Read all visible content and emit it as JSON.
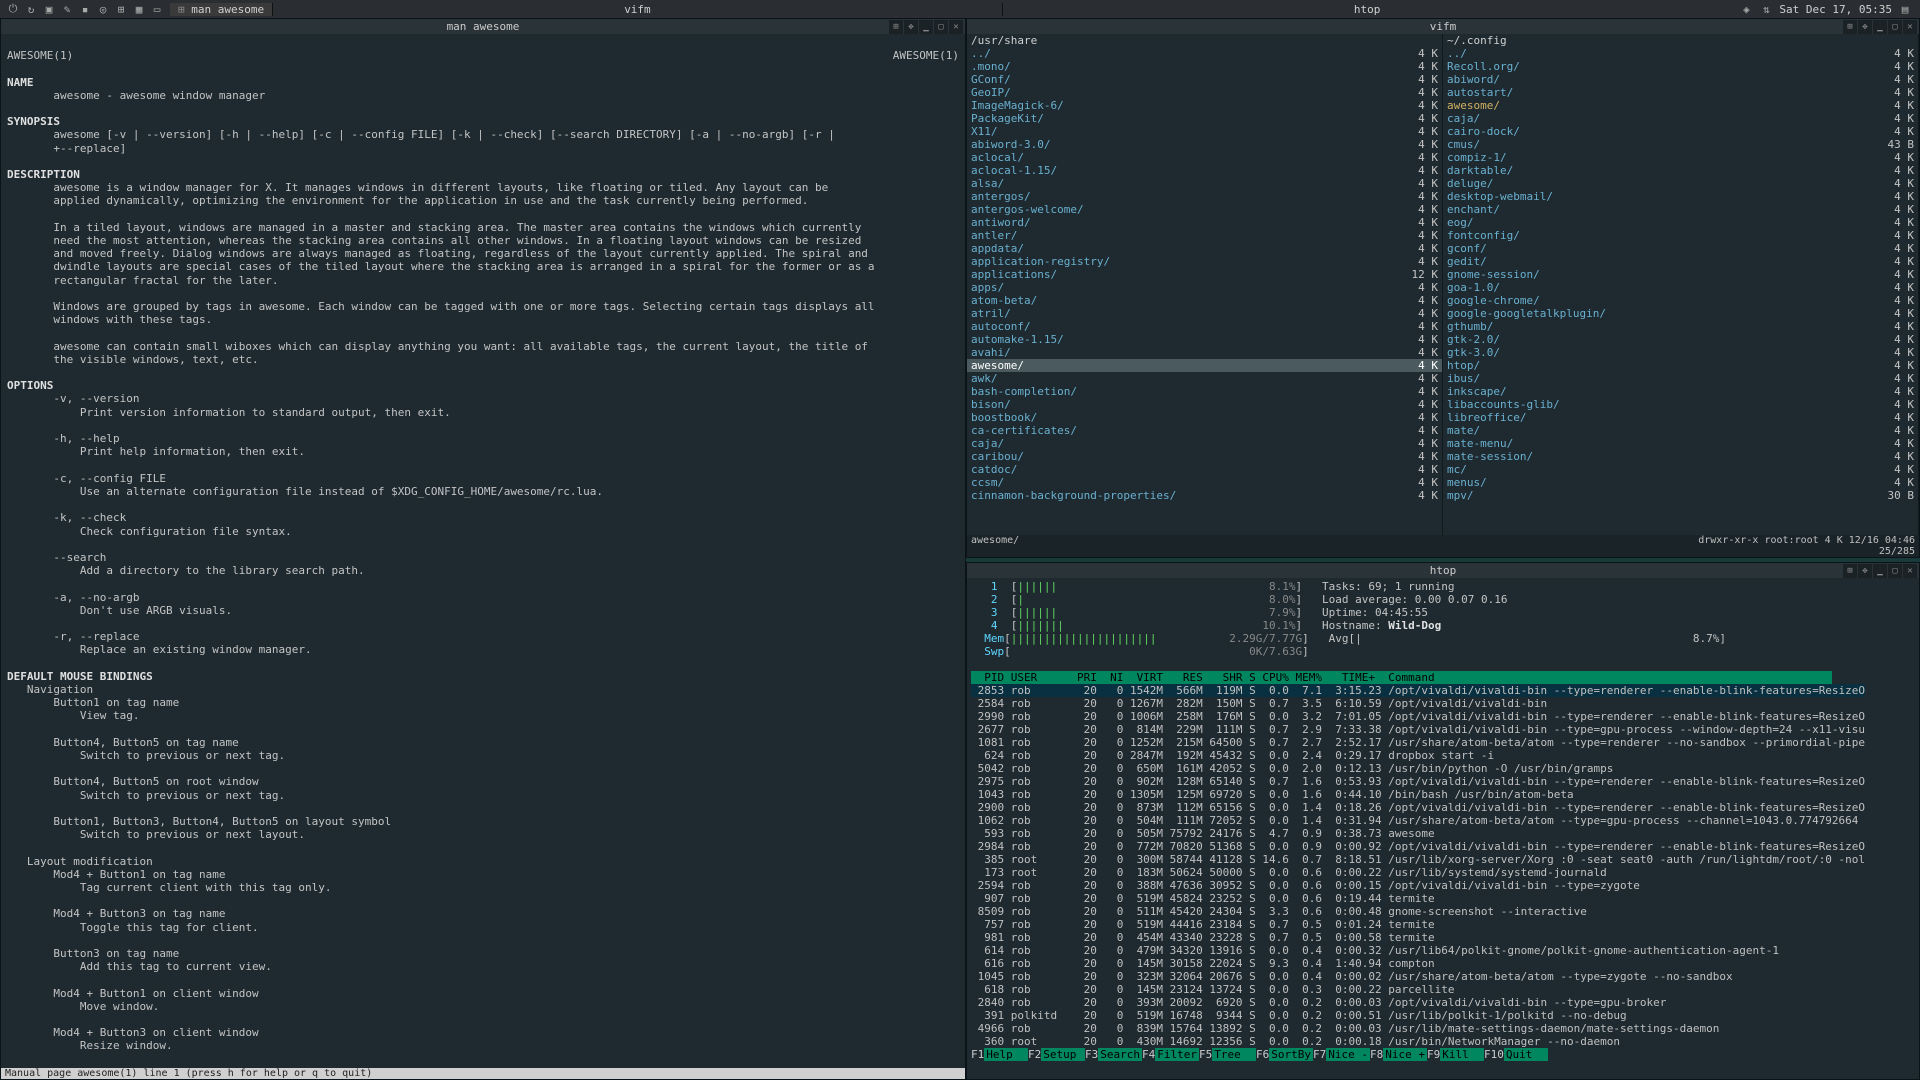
{
  "taskbar": {
    "app_title": "man awesome",
    "tasks": [
      "vifm",
      "htop"
    ],
    "clock": "Sat Dec 17, 05:35",
    "launcher_icons": [
      "power",
      "refresh",
      "folder",
      "edit",
      "terminal",
      "web",
      "files",
      "grid",
      "monitor"
    ],
    "tray_icons": [
      "dropbox",
      "network",
      "volume"
    ]
  },
  "man": {
    "title": "man awesome",
    "header_left": "AWESOME(1)",
    "header_right": "AWESOME(1)",
    "sections": {
      "name_h": "NAME",
      "name_t": "       awesome - awesome window manager",
      "syn_h": "SYNOPSIS",
      "syn_t": "       awesome [-v | --version] [-h | --help] [-c | --config FILE] [-k | --check] [--search DIRECTORY] [-a | --no-argb] [-r |\n       +--replace]",
      "desc_h": "DESCRIPTION",
      "desc_t": "       awesome is a window manager for X. It manages windows in different layouts, like floating or tiled. Any layout can be\n       applied dynamically, optimizing the environment for the application in use and the task currently being performed.\n\n       In a tiled layout, windows are managed in a master and stacking area. The master area contains the windows which currently\n       need the most attention, whereas the stacking area contains all other windows. In a floating layout windows can be resized\n       and moved freely. Dialog windows are always managed as floating, regardless of the layout currently applied. The spiral and\n       dwindle layouts are special cases of the tiled layout where the stacking area is arranged in a spiral for the former or as a\n       rectangular fractal for the later.\n\n       Windows are grouped by tags in awesome. Each window can be tagged with one or more tags. Selecting certain tags displays all\n       windows with these tags.\n\n       awesome can contain small wiboxes which can display anything you want: all available tags, the current layout, the title of\n       the visible windows, text, etc.",
      "opt_h": "OPTIONS",
      "opt_t": "       -v, --version\n           Print version information to standard output, then exit.\n\n       -h, --help\n           Print help information, then exit.\n\n       -c, --config FILE\n           Use an alternate configuration file instead of $XDG_CONFIG_HOME/awesome/rc.lua.\n\n       -k, --check\n           Check configuration file syntax.\n\n       --search\n           Add a directory to the library search path.\n\n       -a, --no-argb\n           Don't use ARGB visuals.\n\n       -r, --replace\n           Replace an existing window manager.",
      "dmb_h": "DEFAULT MOUSE BINDINGS",
      "dmb_t": "   Navigation\n       Button1 on tag name\n           View tag.\n\n       Button4, Button5 on tag name\n           Switch to previous or next tag.\n\n       Button4, Button5 on root window\n           Switch to previous or next tag.\n\n       Button1, Button3, Button4, Button5 on layout symbol\n           Switch to previous or next layout.\n\n   Layout modification\n       Mod4 + Button1 on tag name\n           Tag current client with this tag only.\n\n       Mod4 + Button3 on tag name\n           Toggle this tag for client.\n\n       Button3 on tag name\n           Add this tag to current view.\n\n       Mod4 + Button1 on client window\n           Move window.\n\n       Mod4 + Button3 on client window\n           Resize window."
    },
    "status": " Manual page awesome(1) line 1 (press h for help or q to quit)"
  },
  "vifm": {
    "title": "vifm",
    "left": {
      "path": "/usr/share",
      "selected": "awesome/",
      "items": [
        {
          "n": "../",
          "s": "4 K"
        },
        {
          "n": ".mono/",
          "s": "4 K"
        },
        {
          "n": "GConf/",
          "s": "4 K"
        },
        {
          "n": "GeoIP/",
          "s": "4 K"
        },
        {
          "n": "ImageMagick-6/",
          "s": "4 K"
        },
        {
          "n": "PackageKit/",
          "s": "4 K"
        },
        {
          "n": "X11/",
          "s": "4 K"
        },
        {
          "n": "abiword-3.0/",
          "s": "4 K"
        },
        {
          "n": "aclocal/",
          "s": "4 K"
        },
        {
          "n": "aclocal-1.15/",
          "s": "4 K"
        },
        {
          "n": "alsa/",
          "s": "4 K"
        },
        {
          "n": "antergos/",
          "s": "4 K"
        },
        {
          "n": "antergos-welcome/",
          "s": "4 K"
        },
        {
          "n": "antiword/",
          "s": "4 K"
        },
        {
          "n": "antler/",
          "s": "4 K"
        },
        {
          "n": "appdata/",
          "s": "4 K"
        },
        {
          "n": "application-registry/",
          "s": "4 K"
        },
        {
          "n": "applications/",
          "s": "12 K"
        },
        {
          "n": "apps/",
          "s": "4 K"
        },
        {
          "n": "atom-beta/",
          "s": "4 K"
        },
        {
          "n": "atril/",
          "s": "4 K"
        },
        {
          "n": "autoconf/",
          "s": "4 K"
        },
        {
          "n": "automake-1.15/",
          "s": "4 K"
        },
        {
          "n": "avahi/",
          "s": "4 K"
        },
        {
          "n": "awesome/",
          "s": "4 K",
          "sel": true
        },
        {
          "n": "awk/",
          "s": "4 K"
        },
        {
          "n": "bash-completion/",
          "s": "4 K"
        },
        {
          "n": "bison/",
          "s": "4 K"
        },
        {
          "n": "boostbook/",
          "s": "4 K"
        },
        {
          "n": "ca-certificates/",
          "s": "4 K"
        },
        {
          "n": "caja/",
          "s": "4 K"
        },
        {
          "n": "caribou/",
          "s": "4 K"
        },
        {
          "n": "catdoc/",
          "s": "4 K"
        },
        {
          "n": "ccsm/",
          "s": "4 K"
        },
        {
          "n": "cinnamon-background-properties/",
          "s": "4 K"
        }
      ]
    },
    "right": {
      "path": "~/.config",
      "items": [
        {
          "n": "../",
          "s": "4 K"
        },
        {
          "n": "Recoll.org/",
          "s": "4 K"
        },
        {
          "n": "abiword/",
          "s": "4 K"
        },
        {
          "n": "autostart/",
          "s": "4 K"
        },
        {
          "n": "awesome/",
          "s": "4 K",
          "hi": true
        },
        {
          "n": "caja/",
          "s": "4 K"
        },
        {
          "n": "cairo-dock/",
          "s": "4 K"
        },
        {
          "n": "cmus/",
          "s": "43 B"
        },
        {
          "n": "compiz-1/",
          "s": "4 K"
        },
        {
          "n": "darktable/",
          "s": "4 K"
        },
        {
          "n": "deluge/",
          "s": "4 K"
        },
        {
          "n": "desktop-webmail/",
          "s": "4 K"
        },
        {
          "n": "enchant/",
          "s": "4 K"
        },
        {
          "n": "eog/",
          "s": "4 K"
        },
        {
          "n": "fontconfig/",
          "s": "4 K"
        },
        {
          "n": "gconf/",
          "s": "4 K"
        },
        {
          "n": "gedit/",
          "s": "4 K"
        },
        {
          "n": "gnome-session/",
          "s": "4 K"
        },
        {
          "n": "goa-1.0/",
          "s": "4 K"
        },
        {
          "n": "google-chrome/",
          "s": "4 K"
        },
        {
          "n": "google-googletalkplugin/",
          "s": "4 K"
        },
        {
          "n": "gthumb/",
          "s": "4 K"
        },
        {
          "n": "gtk-2.0/",
          "s": "4 K"
        },
        {
          "n": "gtk-3.0/",
          "s": "4 K"
        },
        {
          "n": "htop/",
          "s": "4 K"
        },
        {
          "n": "ibus/",
          "s": "4 K"
        },
        {
          "n": "inkscape/",
          "s": "4 K"
        },
        {
          "n": "libaccounts-glib/",
          "s": "4 K"
        },
        {
          "n": "libreoffice/",
          "s": "4 K"
        },
        {
          "n": "mate/",
          "s": "4 K"
        },
        {
          "n": "mate-menu/",
          "s": "4 K"
        },
        {
          "n": "mate-session/",
          "s": "4 K"
        },
        {
          "n": "mc/",
          "s": "4 K"
        },
        {
          "n": "menus/",
          "s": "4 K"
        },
        {
          "n": "mpv/",
          "s": "30 B"
        }
      ]
    },
    "status_left": "awesome/",
    "status_mid": "drwxr-xr-x    root:root           4 K   12/16 04:46",
    "status_right": "25/285"
  },
  "htop": {
    "title": "htop",
    "meters": {
      "cpu": [
        {
          "n": "1",
          "bar": "||||||",
          "pct": "8.1%"
        },
        {
          "n": "2",
          "bar": "|",
          "pct": "8.0%"
        },
        {
          "n": "3",
          "bar": "||||||",
          "pct": "7.9%"
        },
        {
          "n": "4",
          "bar": "|||||||",
          "pct": "10.1%"
        }
      ],
      "mem": {
        "label": "Mem",
        "bar": "||||||||||||||||||||||",
        "val": "2.29G/7.77G"
      },
      "swp": {
        "label": "Swp",
        "bar": "",
        "val": "0K/7.63G"
      },
      "tasks": "Tasks: 69; 1 running",
      "load": "Load average: 0.00 0.07 0.16",
      "uptime": "Uptime: 04:45:55",
      "host_l": "Hostname: ",
      "host_v": "Wild-Dog",
      "avg": "Avg[|                                                  8.7%]"
    },
    "header": "  PID USER      PRI  NI  VIRT   RES   SHR S CPU% MEM%   TIME+  Command",
    "procs": [
      {
        "t": " 2853 rob        20   0 1542M  566M  119M S  0.0  7.1  3:15.23 /opt/vivaldi/vivaldi-bin --type=renderer --enable-blink-features=ResizeO",
        "hi": true
      },
      {
        "t": " 2584 rob        20   0 1267M  282M  150M S  0.7  3.5  6:10.59 /opt/vivaldi/vivaldi-bin"
      },
      {
        "t": " 2990 rob        20   0 1006M  258M  176M S  0.0  3.2  7:01.05 /opt/vivaldi/vivaldi-bin --type=renderer --enable-blink-features=ResizeO"
      },
      {
        "t": " 2677 rob        20   0  814M  229M  111M S  0.7  2.9  7:33.38 /opt/vivaldi/vivaldi-bin --type=gpu-process --window-depth=24 --x11-visu"
      },
      {
        "t": " 1081 rob        20   0 1252M  215M 64500 S  0.7  2.7  2:52.17 /usr/share/atom-beta/atom --type=renderer --no-sandbox --primordial-pipe"
      },
      {
        "t": "  624 rob        20   0 2847M  192M 45432 S  0.0  2.4  0:29.17 dropbox start -i"
      },
      {
        "t": " 5042 rob        20   0  650M  161M 42052 S  0.0  2.0  0:12.13 /usr/bin/python -O /usr/bin/gramps"
      },
      {
        "t": " 2975 rob        20   0  902M  128M 65140 S  0.7  1.6  0:53.93 /opt/vivaldi/vivaldi-bin --type=renderer --enable-blink-features=ResizeO"
      },
      {
        "t": " 1043 rob        20   0 1305M  125M 69720 S  0.0  1.6  0:44.10 /bin/bash /usr/bin/atom-beta"
      },
      {
        "t": " 2900 rob        20   0  873M  112M 65156 S  0.0  1.4  0:18.26 /opt/vivaldi/vivaldi-bin --type=renderer --enable-blink-features=ResizeO"
      },
      {
        "t": " 1062 rob        20   0  504M  111M 72052 S  0.0  1.4  0:31.94 /usr/share/atom-beta/atom --type=gpu-process --channel=1043.0.774792664"
      },
      {
        "t": "  593 rob        20   0  505M 75792 24176 S  4.7  0.9  0:38.73 awesome"
      },
      {
        "t": " 2984 rob        20   0  772M 70820 51368 S  0.0  0.9  0:00.92 /opt/vivaldi/vivaldi-bin --type=renderer --enable-blink-features=ResizeO"
      },
      {
        "t": "  385 root       20   0  300M 58744 41128 S 14.6  0.7  8:18.51 /usr/lib/xorg-server/Xorg :0 -seat seat0 -auth /run/lightdm/root/:0 -nol"
      },
      {
        "t": "  173 root       20   0  183M 50624 50000 S  0.0  0.6  0:00.22 /usr/lib/systemd/systemd-journald"
      },
      {
        "t": " 2594 rob        20   0  388M 47636 30952 S  0.0  0.6  0:00.15 /opt/vivaldi/vivaldi-bin --type=zygote"
      },
      {
        "t": "  907 rob        20   0  519M 45824 23252 S  0.0  0.6  0:19.44 termite"
      },
      {
        "t": " 8509 rob        20   0  511M 45420 24304 S  3.3  0.6  0:00.48 gnome-screenshot --interactive"
      },
      {
        "t": "  757 rob        20   0  519M 44416 23184 S  0.7  0.5  0:01.24 termite"
      },
      {
        "t": "  981 rob        20   0  454M 43340 23228 S  0.7  0.5  0:00.58 termite"
      },
      {
        "t": "  614 rob        20   0  479M 34320 13916 S  0.0  0.4  0:00.32 /usr/lib64/polkit-gnome/polkit-gnome-authentication-agent-1"
      },
      {
        "t": "  616 rob        20   0  145M 30158 22024 S  9.3  0.4  1:40.94 compton"
      },
      {
        "t": " 1045 rob        20   0  323M 32064 20676 S  0.0  0.4  0:00.02 /usr/share/atom-beta/atom --type=zygote --no-sandbox"
      },
      {
        "t": "  618 rob        20   0  145M 23124 13724 S  0.0  0.3  0:00.22 parcellite"
      },
      {
        "t": " 2840 rob        20   0  393M 20092  6920 S  0.0  0.2  0:00.03 /opt/vivaldi/vivaldi-bin --type=gpu-broker"
      },
      {
        "t": "  391 polkitd    20   0  519M 16748  9344 S  0.0  0.2  0:00.51 /usr/lib/polkit-1/polkitd --no-debug"
      },
      {
        "t": " 4966 rob        20   0  839M 15764 13892 S  0.0  0.2  0:00.03 /usr/lib/mate-settings-daemon/mate-settings-daemon"
      },
      {
        "t": "  360 root       20   0  430M 14692 12356 S  0.0  0.2  0:00.18 /usr/bin/NetworkManager --no-daemon"
      }
    ],
    "fkeys": [
      {
        "k": "F1",
        "l": "Help"
      },
      {
        "k": "F2",
        "l": "Setup"
      },
      {
        "k": "F3",
        "l": "Search"
      },
      {
        "k": "F4",
        "l": "Filter"
      },
      {
        "k": "F5",
        "l": "Tree"
      },
      {
        "k": "F6",
        "l": "SortBy"
      },
      {
        "k": "F7",
        "l": "Nice -"
      },
      {
        "k": "F8",
        "l": "Nice +"
      },
      {
        "k": "F9",
        "l": "Kill"
      },
      {
        "k": "F10",
        "l": "Quit"
      }
    ]
  }
}
